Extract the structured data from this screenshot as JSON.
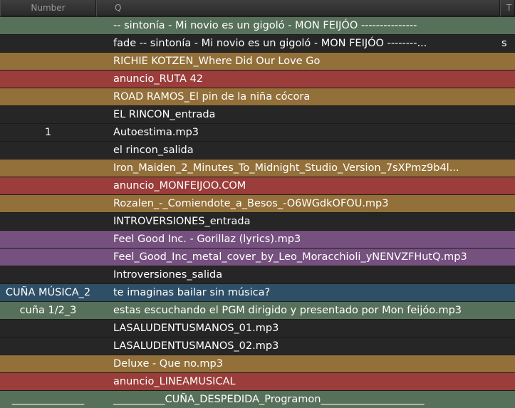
{
  "header": {
    "col_number": "Number",
    "col_q": "Q",
    "col_t": "T"
  },
  "rows": [
    {
      "number": "",
      "q": "-- sintonía - Mi novio es un gigoló - MON  FEIJÓO ---------------",
      "t": "",
      "color": "green"
    },
    {
      "number": "",
      "q": "fade -- sintonía - Mi novio es un gigoló - MON  FEIJÓO --------...",
      "t": "s",
      "color": "dark"
    },
    {
      "number": "",
      "q": "RICHIE KOTZEN_Where Did Our Love Go",
      "t": "",
      "color": "gold"
    },
    {
      "number": "",
      "q": "anuncio_RUTA 42",
      "t": "",
      "color": "red"
    },
    {
      "number": "",
      "q": "ROAD RAMOS_El pin de la niña cócora",
      "t": "",
      "color": "gold"
    },
    {
      "number": "",
      "q": "EL RINCON_entrada",
      "t": "",
      "color": "dark"
    },
    {
      "number": "1",
      "q": "Autoestima.mp3",
      "t": "",
      "color": "dark"
    },
    {
      "number": "",
      "q": "el rincon_salida",
      "t": "",
      "color": "dark"
    },
    {
      "number": "",
      "q": "Iron_Maiden_2_Minutes_To_Midnight_Studio_Version_7sXPmz9b4l...",
      "t": "",
      "color": "gold"
    },
    {
      "number": "",
      "q": "anuncio_MONFEIJOO.COM",
      "t": "",
      "color": "red"
    },
    {
      "number": "",
      "q": "Rozalen_-_Comiendote_a_Besos_-O6WGdkOFOU.mp3",
      "t": "",
      "color": "gold"
    },
    {
      "number": "",
      "q": "INTROVERSIONES_entrada",
      "t": "",
      "color": "dark"
    },
    {
      "number": "",
      "q": "Feel Good Inc. - Gorillaz (lyrics).mp3",
      "t": "",
      "color": "purple"
    },
    {
      "number": "",
      "q": "Feel_Good_Inc_metal_cover_by_Leo_Moracchioli_yNENVZFHutQ.mp3",
      "t": "",
      "color": "purple"
    },
    {
      "number": "",
      "q": "Introversiones_salida",
      "t": "",
      "color": "dark"
    },
    {
      "number": "CUÑA MÚSICA_2",
      "q": "te imaginas bailar sin música?",
      "t": "",
      "color": "blue"
    },
    {
      "number": "cuña 1/2_3",
      "q": "estas escuchando el PGM dirigido y presentado por Mon feijóo.mp3",
      "t": "",
      "color": "green"
    },
    {
      "number": "",
      "q": "LASALUDENTUSMANOS_01.mp3",
      "t": "",
      "color": "dark"
    },
    {
      "number": "",
      "q": "LASALUDENTUSMANOS_02.mp3",
      "t": "",
      "color": "dark"
    },
    {
      "number": "",
      "q": "Deluxe - Que no.mp3",
      "t": "",
      "color": "gold"
    },
    {
      "number": "",
      "q": "anuncio_LINEAMUSICAL",
      "t": "",
      "color": "red"
    },
    {
      "number": "______________",
      "q": "__________CUÑA_DESPEDIDA_Programon____________________",
      "t": "",
      "color": "green"
    }
  ]
}
